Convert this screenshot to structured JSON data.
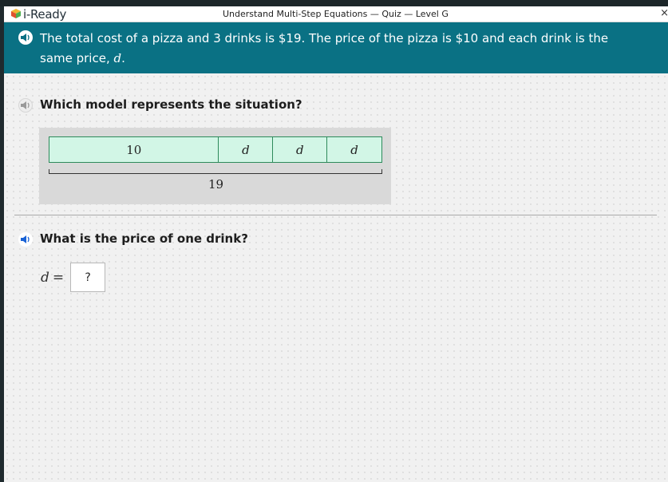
{
  "header": {
    "logo_text": "i-Ready",
    "quiz_title": "Understand Multi-Step Equations — Quiz — Level G",
    "close_label": "×"
  },
  "prompt": {
    "text_main": "The total cost of a pizza and 3 drinks is $19. The price of the pizza is $10 and each drink is the",
    "text_line2_prefix": "same price, ",
    "variable": "d",
    "text_line2_suffix": "."
  },
  "question1": {
    "text": "Which model represents the situation?"
  },
  "model": {
    "segments": [
      "10",
      "d",
      "d",
      "d"
    ],
    "total": "19"
  },
  "question2": {
    "text": "What is the price of one drink?"
  },
  "answer": {
    "lhs_variable": "d",
    "equals": "=",
    "value": "?"
  },
  "colors": {
    "prompt_band": "#0a7184",
    "tape_fill": "#d2f6e6",
    "tape_border": "#2e8a5b",
    "speaker_active": "#1a63d6"
  }
}
